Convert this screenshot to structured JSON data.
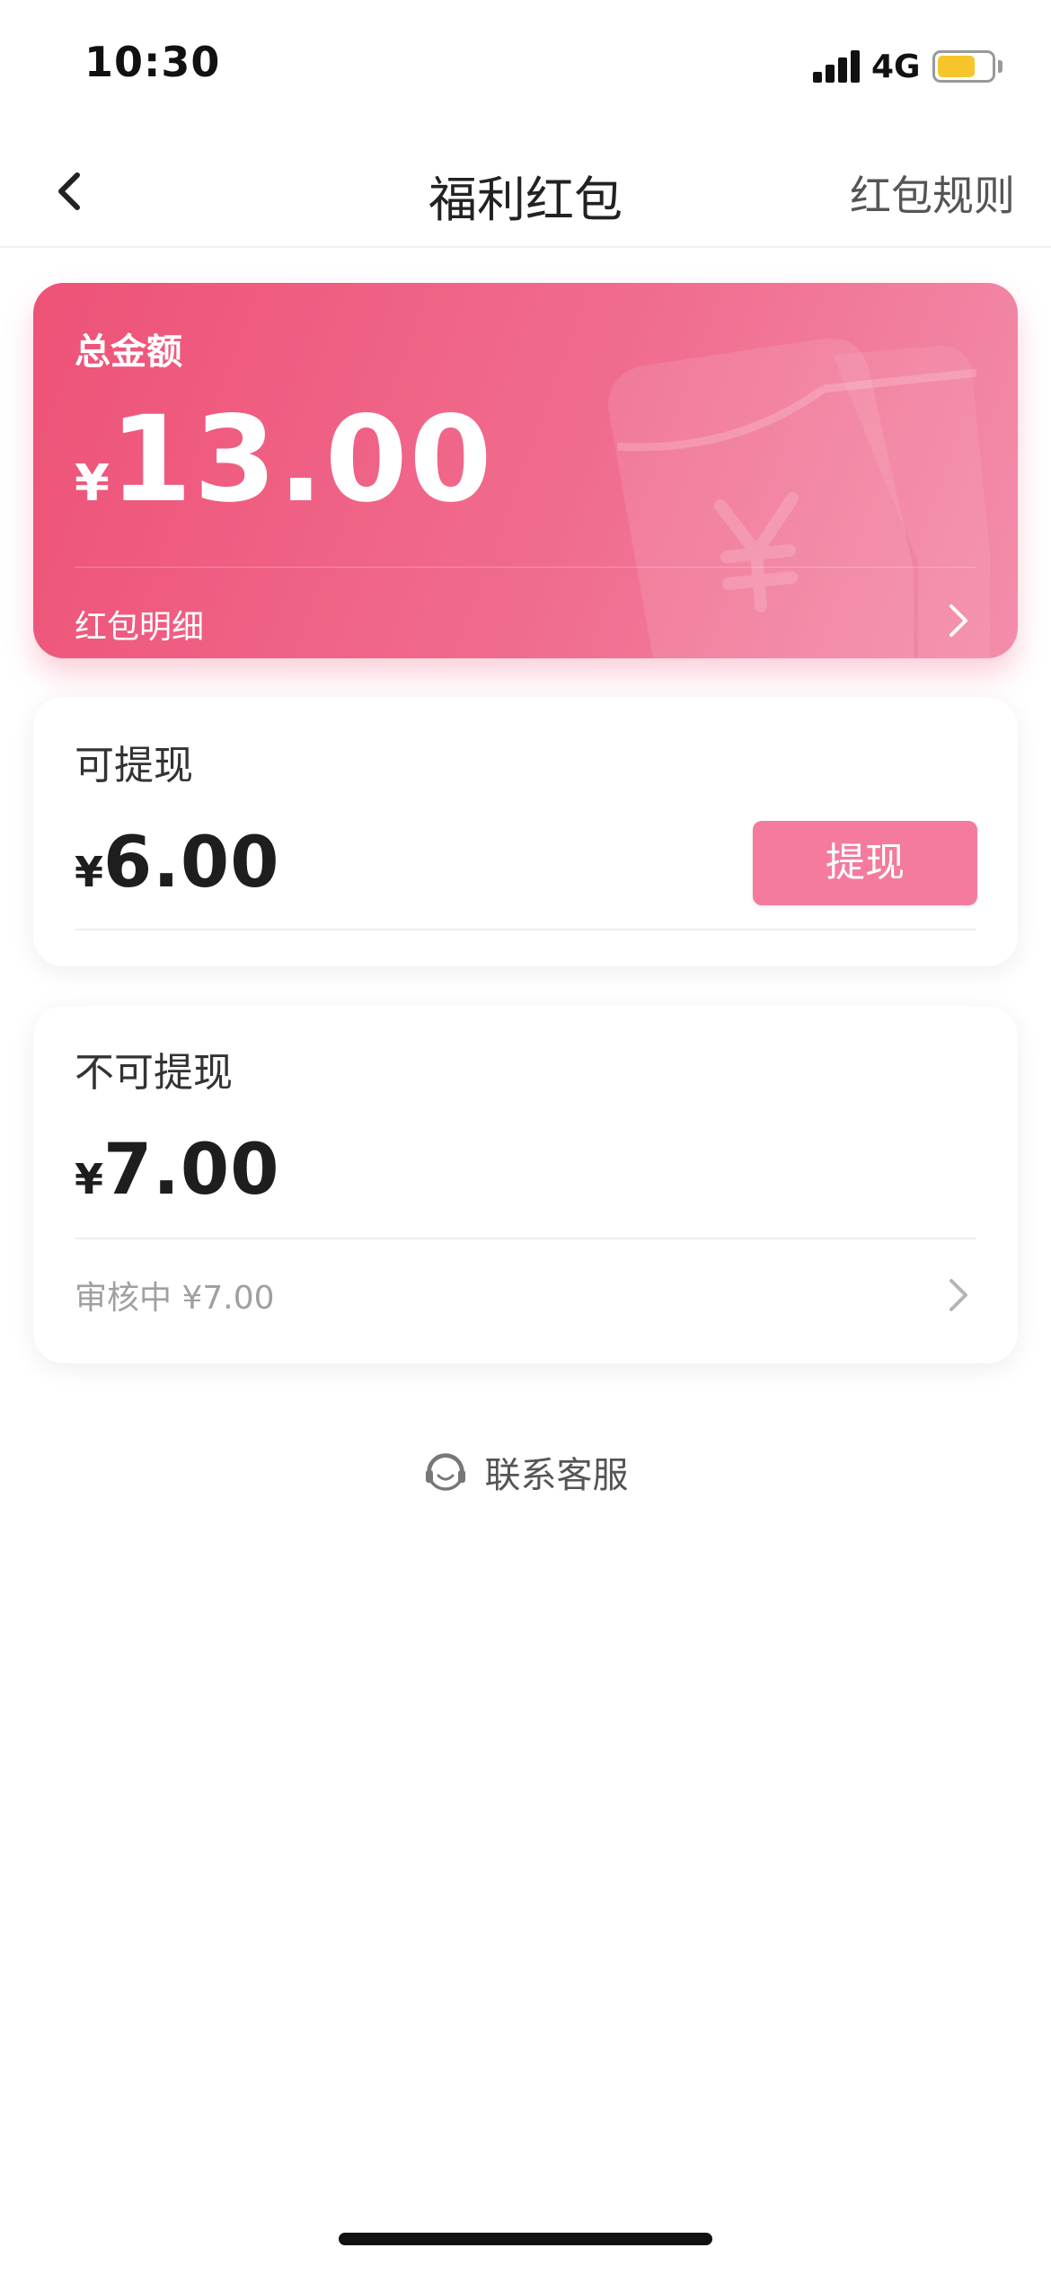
{
  "status_bar": {
    "time": "10:30",
    "network": "4G",
    "battery_level": 0.7,
    "battery_color": "#f6c529"
  },
  "nav": {
    "back_icon": "chevron-left-icon",
    "title": "福利红包",
    "rules_label": "红包规则"
  },
  "total_card": {
    "label": "总金额",
    "currency": "¥",
    "amount": "13.00",
    "detail_label": "红包明细",
    "chevron_icon": "chevron-right-icon",
    "gradient_colors": [
      "#ee5277",
      "#f38dab"
    ]
  },
  "withdrawable": {
    "title": "可提现",
    "currency": "¥",
    "amount": "6.00",
    "button_label": "提现",
    "button_color": "#f47b9d"
  },
  "non_withdrawable": {
    "title": "不可提现",
    "currency": "¥",
    "amount": "7.00",
    "review_text": "审核中 ¥7.00",
    "chevron_icon": "chevron-right-icon"
  },
  "customer_service": {
    "icon": "headset-icon",
    "label": "联系客服"
  }
}
